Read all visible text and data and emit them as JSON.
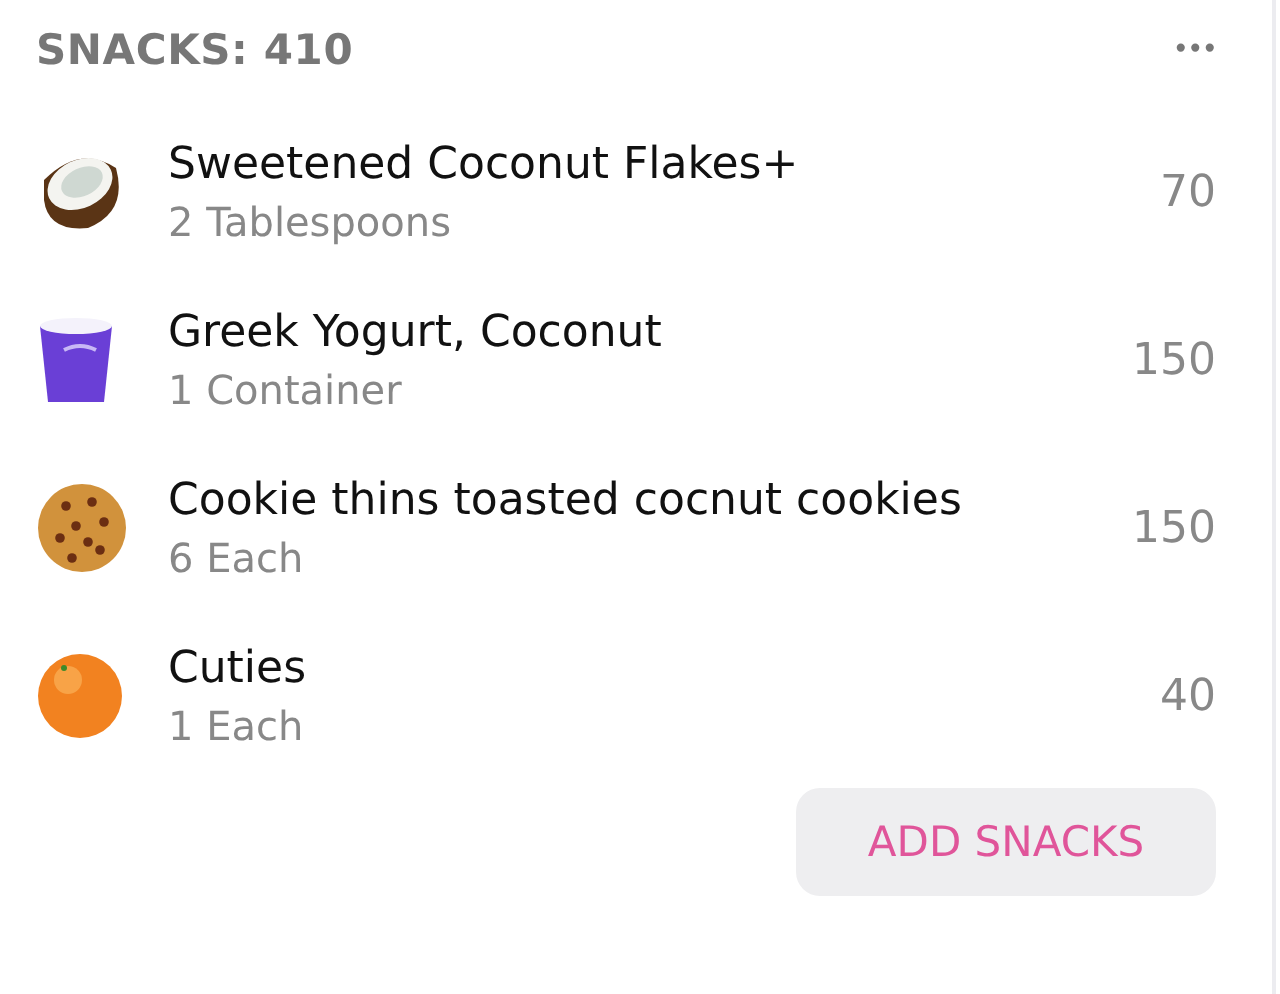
{
  "header": {
    "title": "SNACKS: 410",
    "menu": "•••"
  },
  "items": [
    {
      "kind": "coconut",
      "name": "Sweetened Coconut Flakes+",
      "serving": "2 Tablespoons",
      "calories": "70"
    },
    {
      "kind": "yogurt",
      "name": "Greek Yogurt, Coconut",
      "serving": "1 Container",
      "calories": "150"
    },
    {
      "kind": "cookie",
      "name": "Cookie thins toasted cocnut cookies",
      "serving": "6 Each",
      "calories": "150"
    },
    {
      "kind": "orange",
      "name": "Cuties",
      "serving": "1 Each",
      "calories": "40"
    }
  ],
  "button": "ADD SNACKS"
}
